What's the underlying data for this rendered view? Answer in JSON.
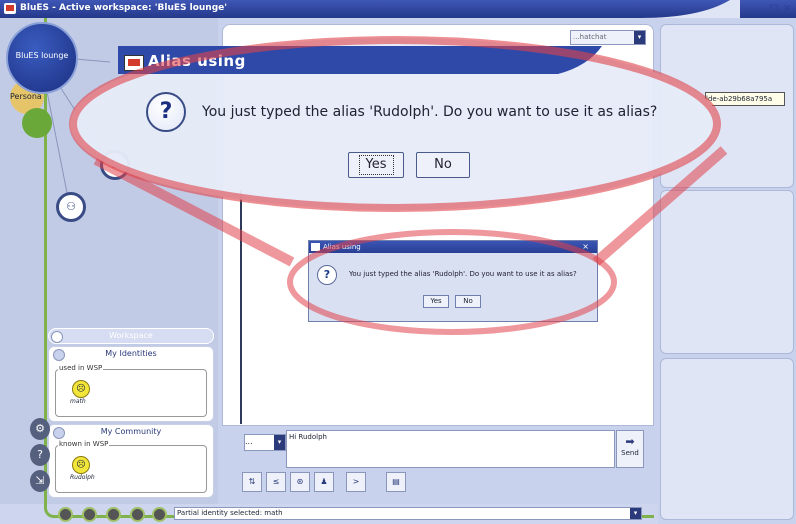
{
  "window": {
    "title": "BluES - Active workspace: 'BluES lounge'",
    "minimize_glyph": "_",
    "maximize_glyph": "□",
    "close_glyph": "×"
  },
  "workspaces": {
    "lounge_label": "BluES lounge",
    "personal_label": "Persona"
  },
  "top_dropdown": {
    "value": "...hatchat",
    "arrow": "▾"
  },
  "alias_field": {
    "value": "lde-ab29b68a795a"
  },
  "left_panel": {
    "workspace_label": "Workspace",
    "identities_title": "My Identities",
    "identities_group": "used in WSP",
    "identity_name": "math",
    "community_title": "My Community",
    "community_group": "known in WSP",
    "community_member": "Rudolph"
  },
  "message_input": {
    "selector_value": "...",
    "text": "Hi Rudolph",
    "send_label": "Send"
  },
  "status_bar": {
    "identity_selector": "Partial identity selected: math"
  },
  "dialog_small": {
    "title": "Alias using",
    "message": "You just typed the alias 'Rudolph'. Do you want to use it as alias?",
    "yes_label": "Yes",
    "no_label": "No",
    "close_glyph": "×"
  },
  "dialog_magnified": {
    "title": "Alias using",
    "message": "You just typed the alias 'Rudolph'. Do you want to use it as alias?",
    "yes_label": "Yes",
    "no_label": "No"
  },
  "colors": {
    "title_bar": "#2a3f95",
    "accent_green": "#7fb24a",
    "panel_bg": "#c9d2ec",
    "highlight_ring": "#e0424a"
  }
}
